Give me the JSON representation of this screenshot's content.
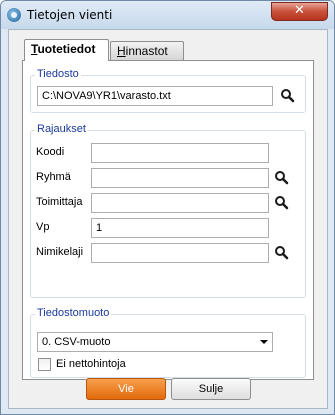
{
  "window": {
    "title": "Tietojen vienti",
    "close_glyph": "✕"
  },
  "tabs": [
    {
      "label": "Tuotetiedot",
      "underline": "T",
      "rest": "uotetiedot",
      "active": true
    },
    {
      "label": "Hinnastot",
      "underline": "H",
      "rest": "innastot",
      "active": false
    }
  ],
  "tiedosto": {
    "title": "Tiedosto",
    "path": "C:\\NOVA9\\YR1\\varasto.txt"
  },
  "rajaukset": {
    "title": "Rajaukset",
    "fields": [
      {
        "label": "Koodi",
        "value": "",
        "has_search": false
      },
      {
        "label": "Ryhmä",
        "value": "",
        "has_search": true
      },
      {
        "label": "Toimittaja",
        "value": "",
        "has_search": true
      },
      {
        "label": "Vp",
        "value": "1",
        "has_search": false
      },
      {
        "label": "Nimikelaji",
        "value": "",
        "has_search": true
      }
    ]
  },
  "tiedostomuoto": {
    "title": "Tiedostomuoto",
    "selected": "0. CSV-muoto",
    "checkbox_label": "Ei nettohintoja",
    "checked": false
  },
  "buttons": {
    "primary": "Vie",
    "secondary": "Sulje"
  },
  "icons": {
    "search": "search-icon",
    "close": "close-icon",
    "app": "app-icon"
  }
}
